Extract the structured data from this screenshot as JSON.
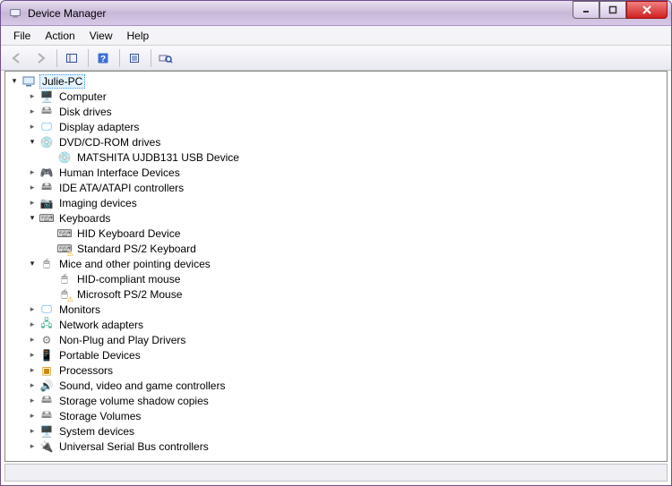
{
  "window": {
    "title": "Device Manager"
  },
  "menu": {
    "file": "File",
    "action": "Action",
    "view": "View",
    "help": "Help"
  },
  "tree": {
    "root": "Julie-PC",
    "computer": "Computer",
    "disk_drives": "Disk drives",
    "display_adapters": "Display adapters",
    "dvd": "DVD/CD-ROM drives",
    "dvd_child": "MATSHITA UJDB131 USB Device",
    "hid": "Human Interface Devices",
    "ide": "IDE ATA/ATAPI controllers",
    "imaging": "Imaging devices",
    "keyboards": "Keyboards",
    "kbd_hid": "HID Keyboard Device",
    "kbd_ps2": "Standard PS/2 Keyboard",
    "mice": "Mice and other pointing devices",
    "mouse_hid": "HID-compliant mouse",
    "mouse_ps2": "Microsoft PS/2 Mouse",
    "monitors": "Monitors",
    "network": "Network adapters",
    "nonpnp": "Non-Plug and Play Drivers",
    "portable": "Portable Devices",
    "processors": "Processors",
    "sound": "Sound, video and game controllers",
    "shadow": "Storage volume shadow copies",
    "storage": "Storage Volumes",
    "system": "System devices",
    "usb": "Universal Serial Bus controllers"
  }
}
